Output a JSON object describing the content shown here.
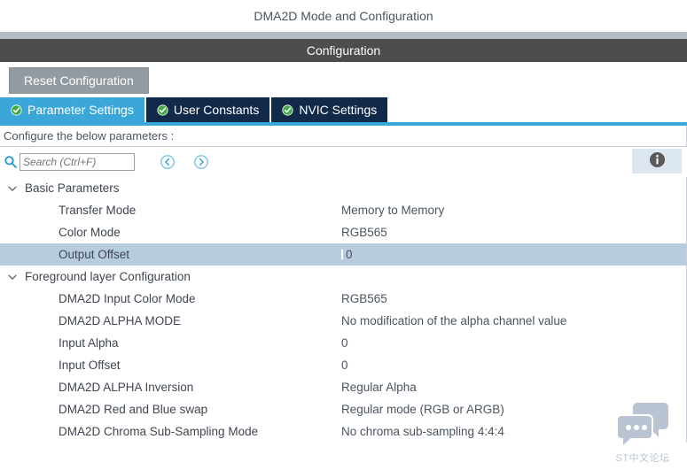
{
  "window": {
    "title": "DMA2D Mode and Configuration"
  },
  "config_bar": {
    "label": "Configuration"
  },
  "toolbar": {
    "reset_label": "Reset Configuration"
  },
  "tabs": [
    {
      "label": "Parameter Settings",
      "icon": "green-check-icon",
      "active": true
    },
    {
      "label": "User Constants",
      "icon": "green-check-icon",
      "active": false
    },
    {
      "label": "NVIC Settings",
      "icon": "green-check-icon",
      "active": false
    }
  ],
  "hint": {
    "text": "Configure the below parameters :"
  },
  "search": {
    "placeholder": "Search (Ctrl+F)",
    "value": "",
    "icon": "search-icon",
    "prev_icon": "chevron-left-circle-icon",
    "next_icon": "chevron-right-circle-icon",
    "info_icon": "info-icon"
  },
  "groups": [
    {
      "label": "Basic Parameters",
      "expanded": true,
      "rows": [
        {
          "name": "Transfer Mode",
          "value": "Memory to Memory",
          "selected": false
        },
        {
          "name": "Color Mode",
          "value": "RGB565",
          "selected": false
        },
        {
          "name": "Output Offset",
          "value": "0",
          "selected": true
        }
      ]
    },
    {
      "label": "Foreground layer Configuration",
      "expanded": true,
      "rows": [
        {
          "name": "DMA2D Input Color Mode",
          "value": "RGB565",
          "selected": false
        },
        {
          "name": "DMA2D ALPHA MODE",
          "value": "No modification of the alpha channel value",
          "selected": false
        },
        {
          "name": "Input Alpha",
          "value": "0",
          "selected": false
        },
        {
          "name": "Input Offset",
          "value": "0",
          "selected": false
        },
        {
          "name": "DMA2D ALPHA Inversion",
          "value": "Regular Alpha",
          "selected": false
        },
        {
          "name": "DMA2D Red and Blue swap",
          "value": "Regular mode (RGB or ARGB)",
          "selected": false
        },
        {
          "name": "DMA2D Chroma Sub-Sampling Mode",
          "value": "No chroma sub-sampling 4:4:4",
          "selected": false
        }
      ]
    }
  ],
  "watermark": {
    "text": "ST中文论坛",
    "icon": "speech-bubbles-icon"
  },
  "colors": {
    "accent": "#3ba7d8",
    "tab_inactive": "#112a4a",
    "config_bar": "#4d4d4d",
    "selection": "#b8cce0",
    "reset_button": "#939ba2",
    "check_green": "#3faa45"
  }
}
